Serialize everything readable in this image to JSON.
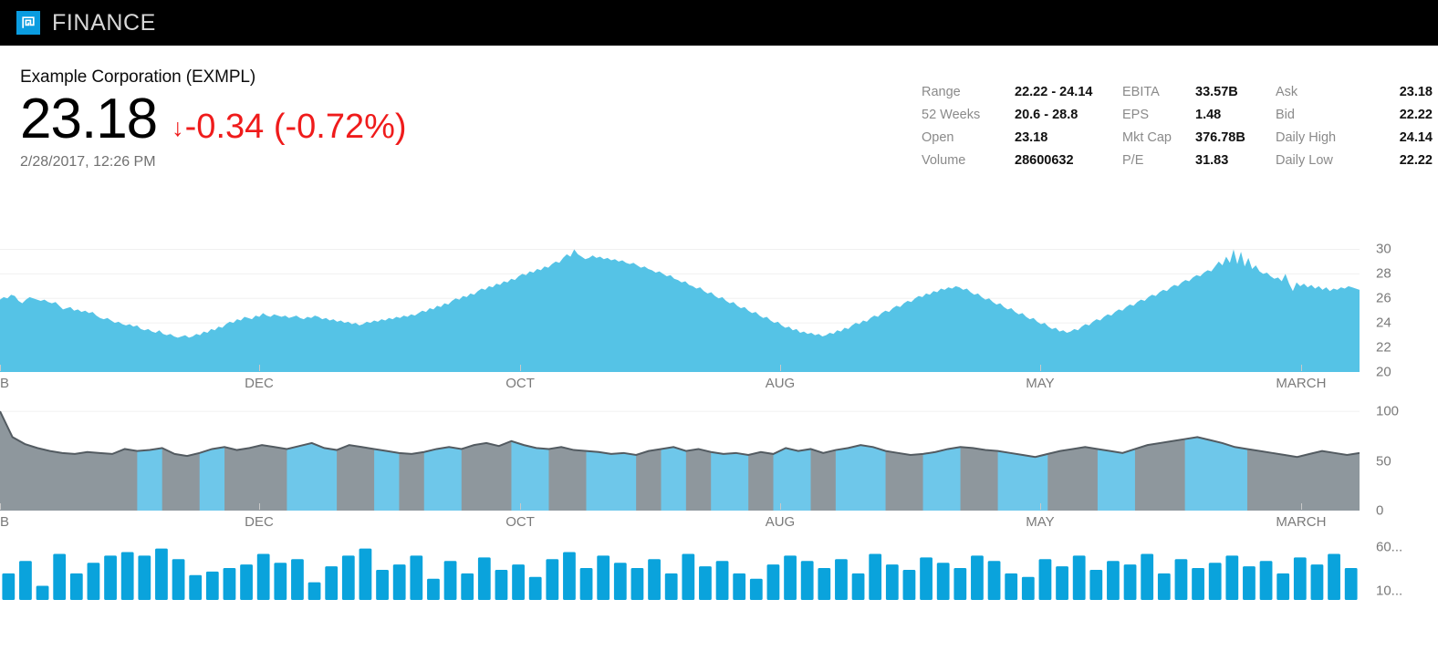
{
  "app": {
    "title": "FINANCE",
    "logo_icon": "finance-logo-icon",
    "logo_color": "#0a9ce0",
    "bar_color": "#000000"
  },
  "quote": {
    "company": "Example Corporation (EXMPL)",
    "price": "23.18",
    "change_arrow": "↓",
    "change": "-0.34 (-0.72%)",
    "change_color": "#ef1b1b",
    "timestamp": "2/28/2017, 12:26 PM"
  },
  "stats": {
    "columns": [
      {
        "rows": [
          {
            "label": "Range",
            "value": "22.22 - 24.14"
          },
          {
            "label": "52 Weeks",
            "value": "20.6 - 28.8"
          },
          {
            "label": "Open",
            "value": "23.18"
          },
          {
            "label": "Volume",
            "value": "28600632"
          }
        ]
      },
      {
        "rows": [
          {
            "label": "EBITA",
            "value": "33.57B"
          },
          {
            "label": "EPS",
            "value": "1.48"
          },
          {
            "label": "Mkt Cap",
            "value": "376.78B"
          },
          {
            "label": "P/E",
            "value": "31.83"
          }
        ]
      },
      {
        "rows": [
          {
            "label": "Ask",
            "value": "23.18"
          },
          {
            "label": "Bid",
            "value": "22.22"
          },
          {
            "label": "Daily High",
            "value": "24.14"
          },
          {
            "label": "Daily Low",
            "value": "22.22"
          }
        ]
      }
    ]
  },
  "chart_data": [
    {
      "id": "price-area-chart",
      "type": "area",
      "title": "",
      "xlabel": "",
      "ylabel": "",
      "grid": true,
      "legend": null,
      "fill_color": "#55c3e6",
      "ylim": [
        20,
        31
      ],
      "yticks": [
        20,
        22,
        24,
        26,
        28,
        30
      ],
      "xticks": [
        {
          "label": "EB",
          "pos": 0.0
        },
        {
          "label": "DEC",
          "pos": 0.1906
        },
        {
          "label": "OCT",
          "pos": 0.3826
        },
        {
          "label": "AUG",
          "pos": 0.5738
        },
        {
          "label": "MAY",
          "pos": 0.7651
        },
        {
          "label": "MARCH",
          "pos": 0.957
        }
      ],
      "values": [
        25.9,
        26.1,
        26.0,
        26.3,
        26.2,
        25.8,
        25.6,
        25.9,
        26.1,
        26.0,
        25.9,
        25.8,
        25.9,
        25.7,
        25.6,
        25.7,
        25.4,
        25.1,
        25.2,
        25.3,
        25.0,
        25.1,
        24.9,
        25.0,
        24.8,
        24.9,
        24.6,
        24.4,
        24.3,
        24.4,
        24.2,
        24.0,
        24.1,
        23.9,
        23.8,
        23.9,
        23.7,
        23.8,
        23.5,
        23.4,
        23.5,
        23.3,
        23.2,
        23.4,
        23.1,
        23.0,
        23.1,
        22.9,
        22.8,
        22.9,
        23.0,
        22.8,
        22.9,
        23.1,
        23.0,
        23.3,
        23.2,
        23.5,
        23.4,
        23.7,
        23.6,
        23.9,
        24.1,
        24.0,
        24.3,
        24.2,
        24.5,
        24.4,
        24.3,
        24.6,
        24.5,
        24.8,
        24.6,
        24.5,
        24.7,
        24.6,
        24.5,
        24.6,
        24.4,
        24.5,
        24.6,
        24.4,
        24.3,
        24.5,
        24.4,
        24.6,
        24.5,
        24.3,
        24.4,
        24.2,
        24.3,
        24.1,
        24.2,
        24.0,
        24.1,
        23.9,
        24.0,
        23.8,
        23.9,
        24.1,
        24.0,
        24.2,
        24.1,
        24.3,
        24.2,
        24.4,
        24.3,
        24.5,
        24.4,
        24.6,
        24.5,
        24.7,
        24.6,
        24.8,
        25.0,
        24.9,
        25.2,
        25.1,
        25.4,
        25.3,
        25.6,
        25.5,
        25.8,
        26.0,
        25.9,
        26.2,
        26.1,
        26.4,
        26.3,
        26.6,
        26.8,
        26.7,
        27.0,
        26.9,
        27.2,
        27.1,
        27.4,
        27.3,
        27.6,
        27.5,
        27.8,
        28.0,
        27.9,
        28.2,
        28.1,
        28.4,
        28.3,
        28.6,
        28.5,
        28.8,
        29.0,
        28.9,
        29.3,
        29.6,
        29.4,
        30.0,
        29.6,
        29.4,
        29.2,
        29.3,
        29.5,
        29.3,
        29.4,
        29.2,
        29.3,
        29.1,
        29.2,
        29.0,
        29.1,
        28.9,
        28.8,
        28.9,
        28.7,
        28.5,
        28.6,
        28.4,
        28.3,
        28.1,
        28.2,
        28.0,
        27.8,
        27.9,
        27.6,
        27.5,
        27.3,
        27.4,
        27.1,
        27.0,
        26.8,
        26.9,
        26.6,
        26.4,
        26.5,
        26.2,
        26.0,
        26.1,
        25.8,
        25.6,
        25.7,
        25.4,
        25.2,
        25.3,
        25.0,
        24.8,
        24.9,
        24.6,
        24.4,
        24.5,
        24.2,
        24.0,
        24.1,
        23.8,
        23.6,
        23.7,
        23.4,
        23.5,
        23.2,
        23.3,
        23.1,
        23.2,
        23.0,
        23.1,
        22.9,
        23.0,
        23.2,
        23.1,
        23.4,
        23.3,
        23.6,
        23.5,
        23.8,
        24.0,
        23.9,
        24.2,
        24.1,
        24.4,
        24.6,
        24.5,
        24.8,
        25.0,
        24.9,
        25.2,
        25.4,
        25.3,
        25.6,
        25.8,
        25.7,
        26.0,
        26.2,
        26.1,
        26.4,
        26.3,
        26.6,
        26.5,
        26.8,
        26.7,
        26.9,
        26.8,
        27.0,
        26.9,
        26.7,
        26.8,
        26.5,
        26.3,
        26.4,
        26.1,
        25.9,
        26.0,
        25.7,
        25.5,
        25.6,
        25.3,
        25.1,
        25.2,
        24.9,
        24.7,
        24.8,
        24.5,
        24.3,
        24.4,
        24.1,
        23.9,
        24.0,
        23.7,
        23.5,
        23.6,
        23.3,
        23.4,
        23.2,
        23.3,
        23.5,
        23.4,
        23.7,
        23.9,
        23.8,
        24.1,
        24.3,
        24.2,
        24.5,
        24.7,
        24.6,
        24.9,
        25.1,
        25.0,
        25.3,
        25.5,
        25.4,
        25.7,
        25.9,
        25.8,
        26.1,
        26.3,
        26.2,
        26.5,
        26.7,
        26.6,
        26.9,
        27.1,
        27.0,
        27.3,
        27.5,
        27.4,
        27.7,
        27.9,
        27.8,
        28.1,
        28.3,
        28.2,
        28.6,
        29.0,
        28.7,
        29.4,
        28.9,
        30.0,
        28.8,
        29.8,
        28.6,
        29.3,
        28.4,
        28.7,
        28.2,
        28.0,
        28.1,
        27.8,
        27.6,
        27.7,
        27.4,
        28.0,
        27.2,
        26.6,
        27.3,
        27.0,
        27.2,
        26.9,
        27.1,
        26.8,
        27.0,
        26.7,
        26.9,
        26.6,
        26.8,
        26.7,
        26.9,
        26.8,
        27.0,
        26.9,
        26.8,
        26.7
      ]
    },
    {
      "id": "volume-area-chart",
      "type": "area",
      "title": "",
      "xlabel": "",
      "ylabel": "",
      "grid": true,
      "legend": null,
      "fill_color": "#8e979d",
      "band_color": "#6ec7ea",
      "line_color": "#535b61",
      "ylim": [
        0,
        112
      ],
      "yticks": [
        0,
        50,
        100
      ],
      "xticks": [
        {
          "label": "EB",
          "pos": 0.0
        },
        {
          "label": "DEC",
          "pos": 0.1906
        },
        {
          "label": "OCT",
          "pos": 0.3826
        },
        {
          "label": "AUG",
          "pos": 0.5738
        },
        {
          "label": "MAY",
          "pos": 0.7651
        },
        {
          "label": "MARCH",
          "pos": 0.957
        }
      ],
      "values": [
        100,
        74,
        67,
        63,
        60,
        58,
        57,
        59,
        58,
        57,
        62,
        60,
        61,
        63,
        57,
        55,
        58,
        62,
        64,
        61,
        63,
        66,
        64,
        62,
        65,
        68,
        63,
        61,
        66,
        64,
        62,
        60,
        58,
        57,
        59,
        62,
        64,
        62,
        66,
        68,
        65,
        70,
        66,
        63,
        62,
        64,
        61,
        60,
        59,
        57,
        58,
        56,
        60,
        62,
        64,
        60,
        62,
        59,
        57,
        58,
        56,
        59,
        57,
        63,
        60,
        62,
        58,
        61,
        63,
        66,
        64,
        60,
        58,
        56,
        57,
        59,
        62,
        64,
        63,
        61,
        60,
        58,
        56,
        54,
        57,
        60,
        62,
        64,
        62,
        60,
        58,
        62,
        66,
        68,
        70,
        72,
        74,
        71,
        68,
        64,
        62,
        60,
        58,
        56,
        54,
        57,
        60,
        58,
        56,
        58
      ],
      "band_segments": [
        [
          11,
          13
        ],
        [
          16,
          18
        ],
        [
          23,
          27
        ],
        [
          30,
          32
        ],
        [
          34,
          37
        ],
        [
          41,
          44
        ],
        [
          47,
          51
        ],
        [
          53,
          55
        ],
        [
          57,
          60
        ],
        [
          62,
          65
        ],
        [
          67,
          71
        ],
        [
          74,
          77
        ],
        [
          80,
          84
        ],
        [
          88,
          91
        ],
        [
          95,
          100
        ]
      ]
    },
    {
      "id": "trade-bar-chart",
      "type": "bar",
      "title": "",
      "xlabel": "",
      "ylabel": "",
      "grid": false,
      "legend": null,
      "bar_color": "#0aa3dc",
      "ylim": [
        0,
        70
      ],
      "yticks": [
        10,
        60
      ],
      "ytick_labels": [
        "10...",
        "60..."
      ],
      "categories": [],
      "values": [
        30,
        44,
        16,
        52,
        30,
        42,
        50,
        54,
        50,
        58,
        46,
        28,
        32,
        36,
        40,
        52,
        42,
        46,
        20,
        38,
        50,
        58,
        34,
        40,
        50,
        24,
        44,
        30,
        48,
        34,
        40,
        26,
        46,
        54,
        36,
        50,
        42,
        36,
        46,
        30,
        52,
        38,
        44,
        30,
        24,
        40,
        50,
        44,
        36,
        46,
        30,
        52,
        40,
        34,
        48,
        42,
        36,
        50,
        44,
        30,
        26,
        46,
        38,
        50,
        34,
        44,
        40,
        52,
        30,
        46,
        36,
        42,
        50,
        38,
        44,
        30,
        48,
        40,
        52,
        36
      ]
    }
  ]
}
